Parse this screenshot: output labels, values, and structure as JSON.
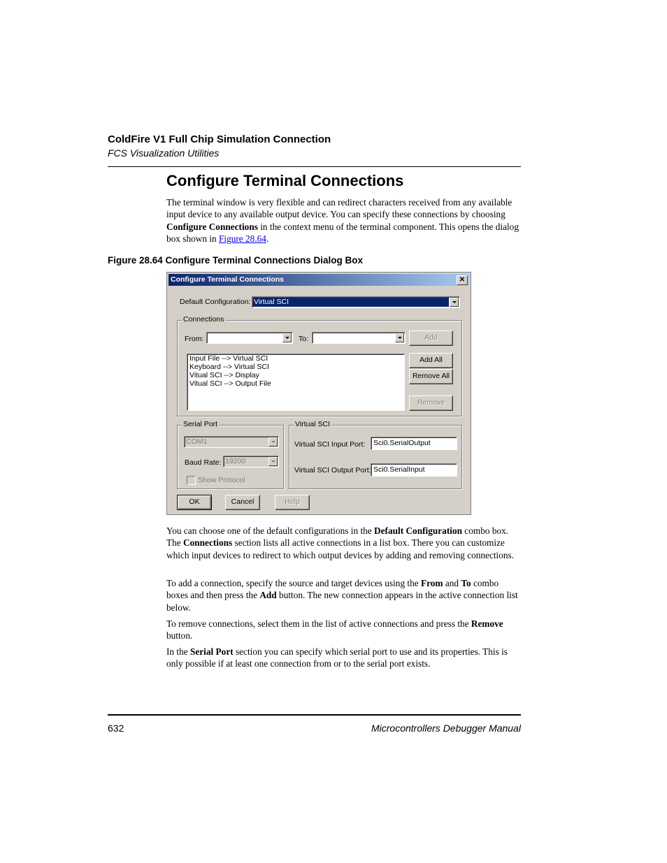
{
  "header": {
    "chapter_title": "ColdFire V1 Full Chip Simulation Connection",
    "section_subtitle": "FCS Visualization Utilities"
  },
  "section": {
    "heading": "Configure Terminal Connections",
    "intro": {
      "t1": "The terminal window is very flexible and can redirect characters received from any available input device to any available output device. You can specify these connections by choosing ",
      "b1": "Configure Connections",
      "t2": " in the context menu of the terminal component. This opens the dialog box shown in ",
      "link": "Figure 28.64",
      "t3": "."
    },
    "figure_caption": "Figure 28.64  Configure Terminal Connections Dialog Box"
  },
  "dialog": {
    "title": "Configure Terminal Connections",
    "close_glyph": "✕",
    "default_config_label": "Default Configuration:",
    "default_config_value": "Virtual SCI",
    "connections_group": "Connections",
    "from_label": "From:",
    "from_value": "",
    "to_label": "To:",
    "to_value": "",
    "add_label": "Add",
    "add_all_label": "Add All",
    "remove_all_label": "Remove All",
    "remove_label": "Remove",
    "connections": [
      "Input File  -->  Virtual SCI",
      "Keyboard  -->  Virtual SCI",
      "Vitual SCI  -->  Display",
      "Vitual SCI  -->  Output File"
    ],
    "serial_port_group": "Serial Port",
    "serial_port_value": "COM1",
    "baud_rate_label": "Baud Rate:",
    "baud_rate_value": "19200",
    "show_protocol_label": "Show Protocol",
    "show_protocol_checked": false,
    "virtual_sci_group": "Virtual SCI",
    "input_port_label": "Virtual SCI Input Port:",
    "input_port_value": "Sci0.SerialOutput",
    "output_port_label": "Virtual SCI Output Port:",
    "output_port_value": "Sci0.SerialInput",
    "ok_label": "OK",
    "cancel_label": "Cancel",
    "help_label": "Help"
  },
  "body": {
    "p1": {
      "t1": "You can choose one of the default configurations in the ",
      "b1": "Default Configuration",
      "t2": " combo box. The ",
      "b2": "Connections",
      "t3": " section lists all active connections in a list box. There you can customize which input devices to redirect to which output devices by adding and removing connections."
    },
    "p2": {
      "t1": "To add a connection, specify the source and target devices using the ",
      "b1": "From",
      "t2": " and ",
      "b2": "To",
      "t3": " combo boxes and then press the ",
      "b3": "Add",
      "t4": " button. The new connection appears in the active connection list below."
    },
    "p3": {
      "t1": "To remove connections, select them in the list of active connections and press the ",
      "b1": "Remove",
      "t2": " button."
    },
    "p4": {
      "t1": "In the ",
      "b1": "Serial Port",
      "t2": " section you can specify which serial port to use and its properties. This is only possible if at least one connection from or to the serial port exists."
    }
  },
  "footer": {
    "page_number": "632",
    "manual_title": "Microcontrollers Debugger Manual"
  }
}
